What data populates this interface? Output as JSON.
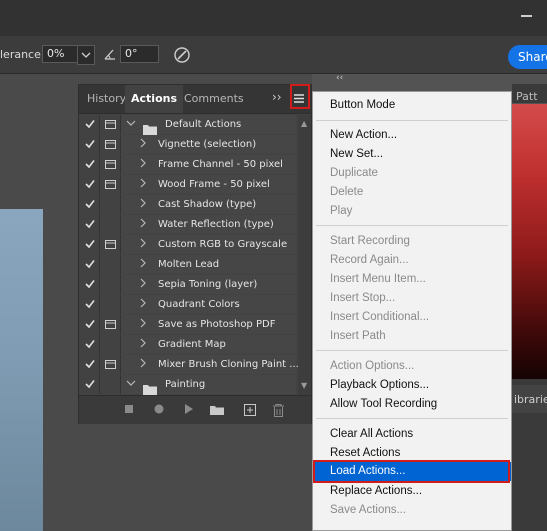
{
  "options_bar": {
    "tolerance_label": "lerance:",
    "tolerance_value": "0%",
    "angle_value": "0°",
    "share_label": "Share"
  },
  "right_panel": {
    "tab_label": "Patt",
    "libraries_label": "ibraries",
    "collapse_glyph": "‹‹"
  },
  "actions_panel": {
    "tabs": [
      {
        "label": "History",
        "active": false
      },
      {
        "label": "Actions",
        "active": true
      },
      {
        "label": "Comments",
        "active": false
      }
    ],
    "more_glyph": "››",
    "rows": [
      {
        "name": "Default Actions",
        "type": "set",
        "checked": true,
        "dialog": true,
        "expanded": true
      },
      {
        "name": "Vignette (selection)",
        "type": "action",
        "checked": true,
        "dialog": true
      },
      {
        "name": "Frame Channel - 50 pixel",
        "type": "action",
        "checked": true,
        "dialog": true
      },
      {
        "name": "Wood Frame - 50 pixel",
        "type": "action",
        "checked": true,
        "dialog": true
      },
      {
        "name": "Cast Shadow (type)",
        "type": "action",
        "checked": true,
        "dialog": false
      },
      {
        "name": "Water Reflection (type)",
        "type": "action",
        "checked": true,
        "dialog": false
      },
      {
        "name": "Custom RGB to Grayscale",
        "type": "action",
        "checked": true,
        "dialog": true
      },
      {
        "name": "Molten Lead",
        "type": "action",
        "checked": true,
        "dialog": false
      },
      {
        "name": "Sepia Toning (layer)",
        "type": "action",
        "checked": true,
        "dialog": false
      },
      {
        "name": "Quadrant Colors",
        "type": "action",
        "checked": true,
        "dialog": false
      },
      {
        "name": "Save as Photoshop PDF",
        "type": "action",
        "checked": true,
        "dialog": true
      },
      {
        "name": "Gradient Map",
        "type": "action",
        "checked": true,
        "dialog": false
      },
      {
        "name": "Mixer Brush Cloning Paint ...",
        "type": "action",
        "checked": true,
        "dialog": true
      },
      {
        "name": "Painting",
        "type": "set",
        "checked": true,
        "dialog": false,
        "expanded": false
      }
    ],
    "footer_icons": [
      "stop-icon",
      "record-icon",
      "play-icon",
      "new-set-icon",
      "new-action-icon",
      "delete-icon"
    ]
  },
  "flyout_menu": {
    "items": [
      {
        "label": "Button Mode",
        "disabled": false
      },
      {
        "label": "New Action...",
        "disabled": false
      },
      {
        "label": "New Set...",
        "disabled": false
      },
      {
        "label": "Duplicate",
        "disabled": true
      },
      {
        "label": "Delete",
        "disabled": true
      },
      {
        "label": "Play",
        "disabled": true
      },
      {
        "label": "Start Recording",
        "disabled": true
      },
      {
        "label": "Record Again...",
        "disabled": true
      },
      {
        "label": "Insert Menu Item...",
        "disabled": true
      },
      {
        "label": "Insert Stop...",
        "disabled": true
      },
      {
        "label": "Insert Conditional...",
        "disabled": true
      },
      {
        "label": "Insert Path",
        "disabled": true
      },
      {
        "label": "Action Options...",
        "disabled": true
      },
      {
        "label": "Playback Options...",
        "disabled": false
      },
      {
        "label": "Allow Tool Recording",
        "disabled": false
      },
      {
        "label": "Clear All Actions",
        "disabled": false
      },
      {
        "label": "Reset Actions",
        "disabled": false
      },
      {
        "label": "Load Actions...",
        "disabled": false,
        "highlighted": true
      },
      {
        "label": "Replace Actions...",
        "disabled": false
      },
      {
        "label": "Save Actions...",
        "disabled": true
      }
    ]
  },
  "colors": {
    "menu_highlight": "#0064d2",
    "callout_outline": "#d21c1c",
    "share_button": "#1473e6"
  }
}
